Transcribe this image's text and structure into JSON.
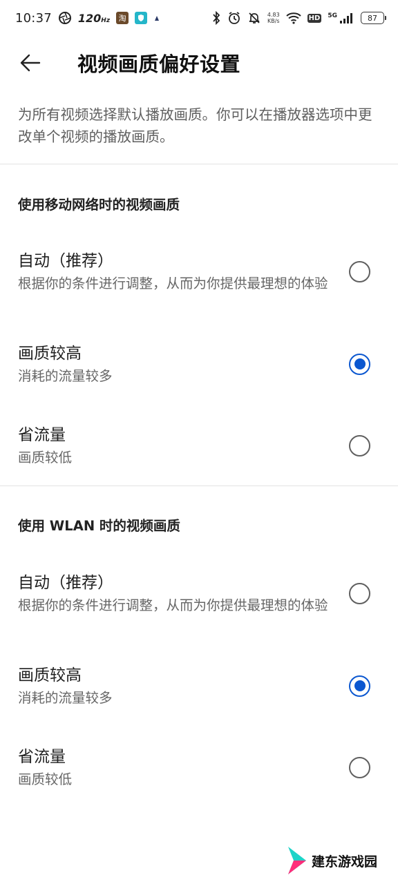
{
  "status_bar": {
    "time": "10:37",
    "refresh_rate": "120",
    "refresh_unit": "Hz",
    "net_speed_value": "4.83",
    "net_speed_unit": "KB/s",
    "hd_label": "HD",
    "network_type": "5G",
    "battery": "87",
    "icons": [
      "camera-shutter-icon",
      "taobao-app-icon",
      "shield-app-icon",
      "notification-dot-icon",
      "bluetooth-icon",
      "alarm-icon",
      "silent-icon",
      "wifi-icon",
      "signal-icon",
      "battery-icon"
    ]
  },
  "header": {
    "back_icon": "arrow-left-icon",
    "title": "视频画质偏好设置"
  },
  "description": "为所有视频选择默认播放画质。你可以在播放器选项中更改单个视频的播放画质。",
  "sections": [
    {
      "title": "使用移动网络时的视频画质",
      "options": [
        {
          "label": "自动（推荐）",
          "sub": "根据你的条件进行调整，从而为你提供最理想的体验",
          "selected": false
        },
        {
          "label": "画质较高",
          "sub": "消耗的流量较多",
          "selected": true
        },
        {
          "label": "省流量",
          "sub": "画质较低",
          "selected": false
        }
      ]
    },
    {
      "title": "使用 WLAN 时的视频画质",
      "options": [
        {
          "label": "自动（推荐）",
          "sub": "根据你的条件进行调整，从而为你提供最理想的体验",
          "selected": false
        },
        {
          "label": "画质较高",
          "sub": "消耗的流量较多",
          "selected": true
        },
        {
          "label": "省流量",
          "sub": "画质较低",
          "selected": false
        }
      ]
    }
  ],
  "watermark": {
    "text": "建东游戏园"
  },
  "colors": {
    "accent": "#0b57d0",
    "radio_unselected": "#5f5f5f",
    "secondary_text": "#666666"
  }
}
